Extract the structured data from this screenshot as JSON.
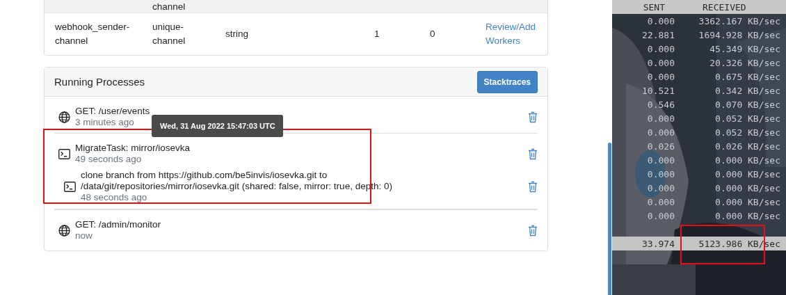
{
  "queue_table": {
    "columns": [
      "",
      "channel",
      "",
      "",
      "",
      "",
      ""
    ],
    "rows": [
      {
        "name": "webhook_sender-channel",
        "type": "unique-channel",
        "data": "string",
        "column_4": "1",
        "column_5": "0",
        "action": "Review/Add Workers"
      }
    ]
  },
  "processes": {
    "title": "Running Processes",
    "button": "Stacktraces",
    "items": [
      {
        "kind": "request",
        "title": "GET: /user/events",
        "time": "3 minutes ago",
        "tooltip": "Wed, 31 Aug 2022 15:47:03 UTC"
      },
      {
        "kind": "task",
        "title": "MigrateTask: mirror/iosevka",
        "time": "49 seconds ago",
        "highlighted": true,
        "children": [
          {
            "kind": "task",
            "title": "clone branch from https://github.com/be5invis/iosevka.git to /data/git/repositories/mirror/iosevka.git (shared: false, mirror: true, depth: 0)",
            "time": "48 seconds ago"
          }
        ]
      },
      {
        "kind": "request",
        "title": "GET: /admin/monitor",
        "time": "now"
      }
    ]
  },
  "terminal": {
    "columns": [
      "SENT",
      "RECEIVED"
    ],
    "rows": [
      {
        "sent": "0.000",
        "received": "3362.167 KB/sec"
      },
      {
        "sent": "22.881",
        "received": "1694.928 KB/sec"
      },
      {
        "sent": "0.000",
        "received": "45.349 KB/sec"
      },
      {
        "sent": "0.000",
        "received": "20.326 KB/sec"
      },
      {
        "sent": "0.000",
        "received": "0.675 KB/sec"
      },
      {
        "sent": "10.521",
        "received": "0.342 KB/sec"
      },
      {
        "sent": "0.546",
        "received": "0.070 KB/sec"
      },
      {
        "sent": "0.000",
        "received": "0.052 KB/sec"
      },
      {
        "sent": "0.000",
        "received": "0.052 KB/sec"
      },
      {
        "sent": "0.026",
        "received": "0.026 KB/sec"
      },
      {
        "sent": "0.000",
        "received": "0.000 KB/sec"
      },
      {
        "sent": "0.000",
        "received": "0.000 KB/sec"
      },
      {
        "sent": "0.000",
        "received": "0.000 KB/sec"
      },
      {
        "sent": "0.000",
        "received": "0.000 KB/sec"
      },
      {
        "sent": "0.000",
        "received": "0.000 KB/sec"
      }
    ],
    "total": {
      "sent": "33.974",
      "received": "5123.986 KB/sec",
      "highlighted": true
    }
  }
}
